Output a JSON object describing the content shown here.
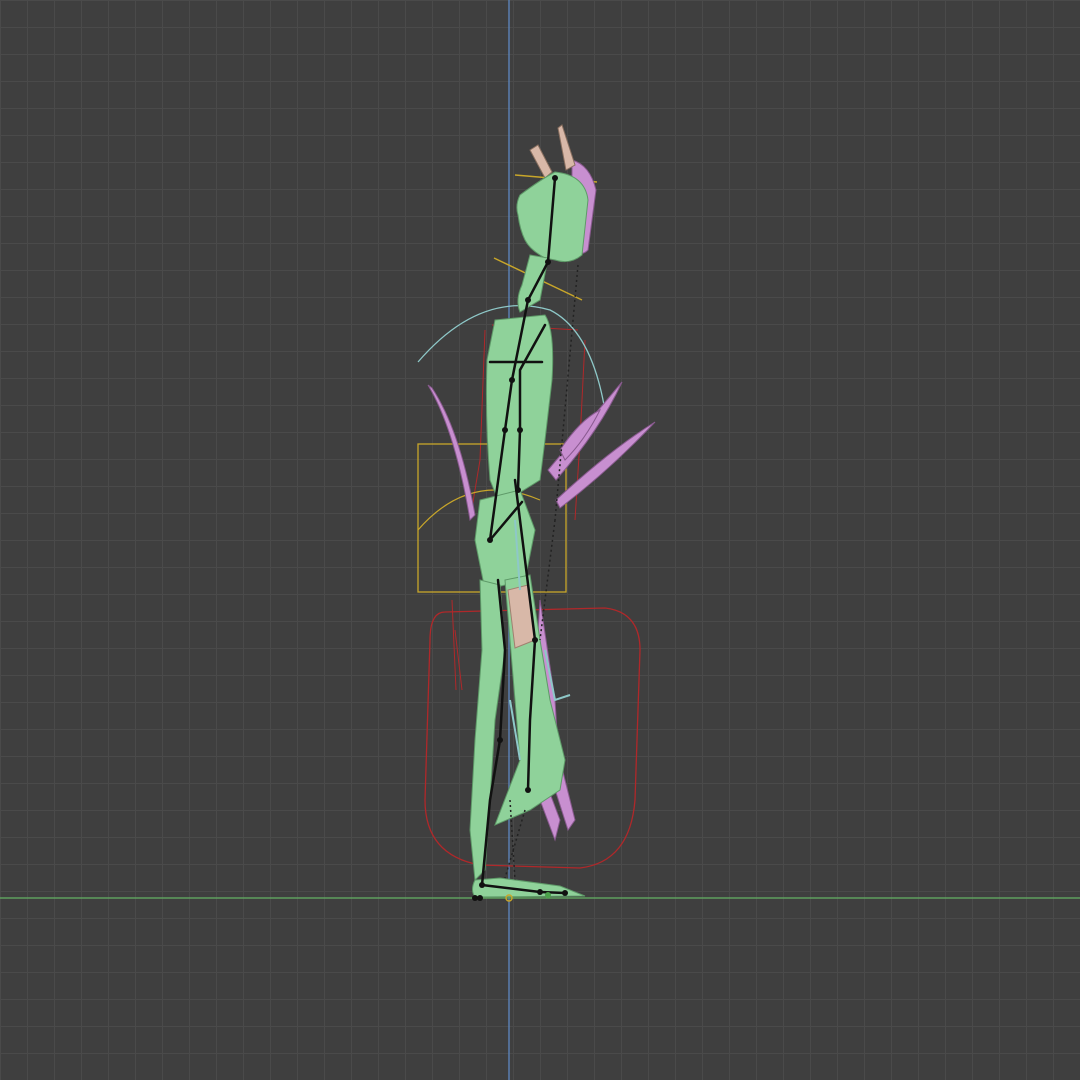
{
  "viewport": {
    "view": "side-orthographic",
    "colors": {
      "background": "#3f3f3f",
      "grid": "#4a4a4a",
      "x_axis": "#5f9f5f",
      "z_axis": "#5a7fb0",
      "mesh": "#8fd29a",
      "mesh_edge": "#6fb07a",
      "accessory": "#c88fd0",
      "armature": "#111111",
      "control_red": "#c0282a",
      "control_yellow": "#c8a62a",
      "control_cyan": "#8ec8c8",
      "skin": "#d8b8a8"
    },
    "objects": [
      {
        "name": "character-mesh",
        "kind": "mesh"
      },
      {
        "name": "armature",
        "kind": "bones"
      },
      {
        "name": "hip-control",
        "kind": "yellow-square"
      },
      {
        "name": "root-control",
        "kind": "red-rounded-rect"
      },
      {
        "name": "chest-control",
        "kind": "cyan-arc"
      }
    ]
  }
}
